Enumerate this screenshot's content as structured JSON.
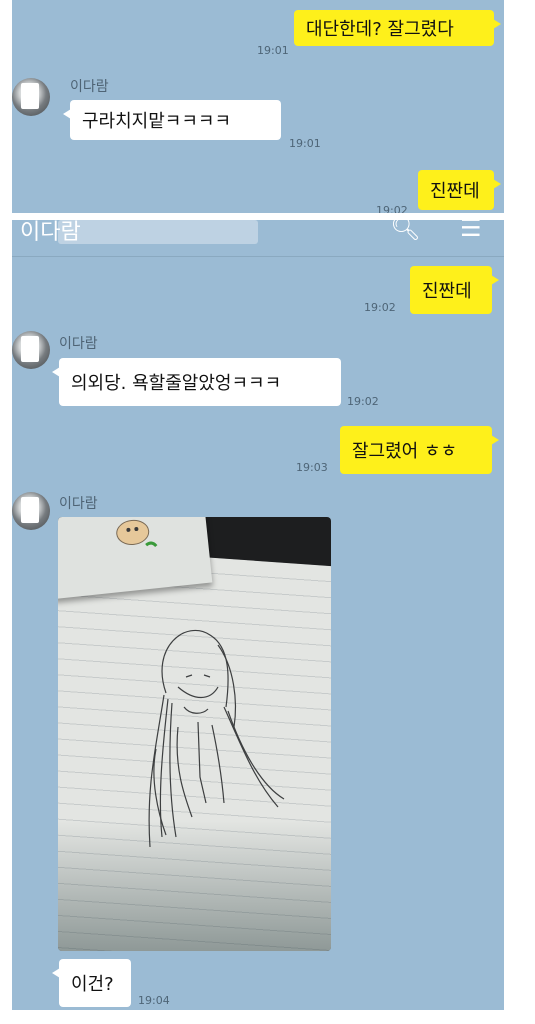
{
  "top": {
    "msg1": {
      "text": "대단한데? 잘그렸다",
      "time": "19:01"
    },
    "msg2": {
      "sender": "이다람",
      "text": "구라치지맡ㅋㅋㅋㅋ",
      "time": "19:01"
    },
    "msg3": {
      "text": "진짠데",
      "time": "19:02"
    }
  },
  "header": {
    "title": "이다람"
  },
  "bottom": {
    "msg1": {
      "text": "진짠데",
      "time": "19:02"
    },
    "msg2": {
      "sender": "이다람",
      "text": "의외당. 욕할줄알았엉ㅋㅋㅋ",
      "time": "19:02"
    },
    "msg3": {
      "text": "잘그렸어 ㅎㅎ",
      "time": "19:03"
    },
    "msg4": {
      "sender": "이다람"
    },
    "msg5": {
      "text": "이건?",
      "time": "19:04"
    }
  },
  "colors": {
    "background": "#9bbbd4",
    "mine_bubble": "#fef01b",
    "theirs_bubble": "#ffffff"
  },
  "icons": {
    "search": "search-icon",
    "menu": "menu-icon"
  }
}
